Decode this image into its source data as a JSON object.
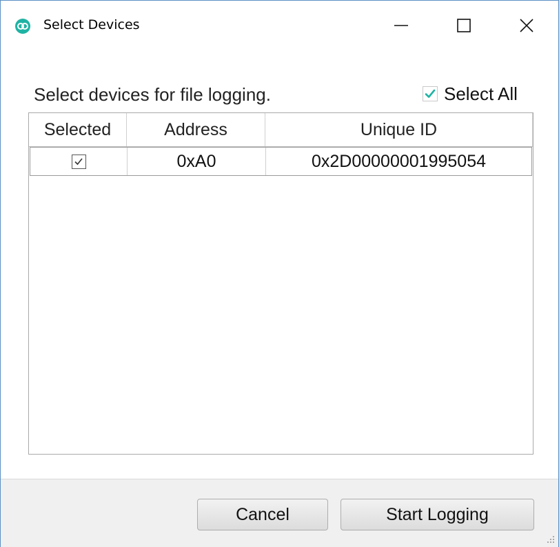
{
  "window": {
    "title": "Select Devices",
    "icon": "maxim-logo-icon",
    "accent_color": "#1fb3a4",
    "controls": {
      "minimize": "minimize-icon",
      "maximize": "maximize-icon",
      "close": "close-icon"
    }
  },
  "instructions": "Select devices for file logging.",
  "select_all": {
    "label": "Select All",
    "checked": true,
    "check_color": "#1fb3a4"
  },
  "table": {
    "columns": [
      "Selected",
      "Address",
      "Unique ID"
    ],
    "rows": [
      {
        "selected": true,
        "address": "0xA0",
        "unique_id": "0x2D00000001995054"
      }
    ]
  },
  "buttons": {
    "cancel": "Cancel",
    "start_logging": "Start Logging"
  }
}
